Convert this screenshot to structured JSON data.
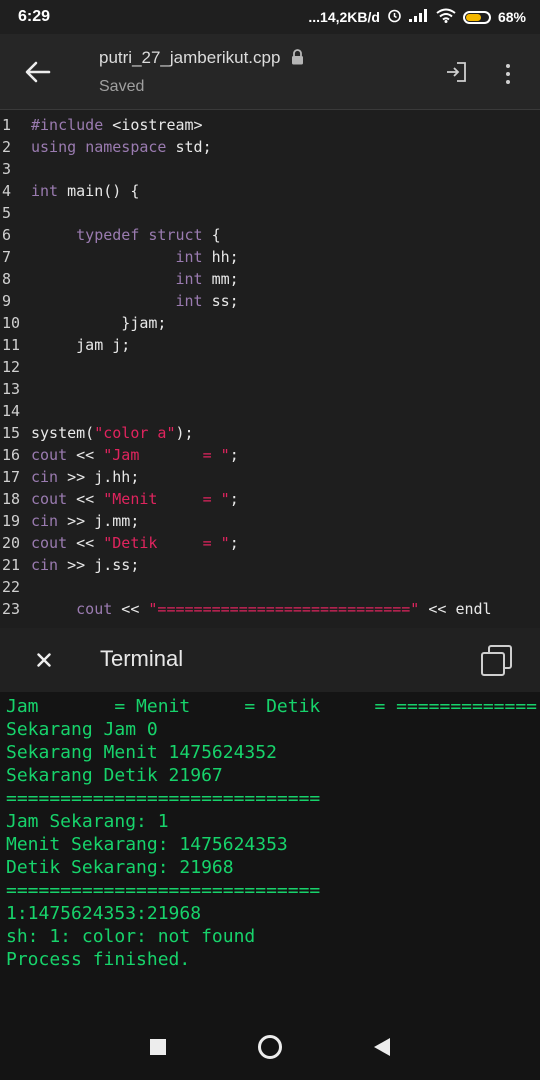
{
  "status_bar": {
    "time": "6:29",
    "network_speed": "...14,2KB/d",
    "battery_percent": "68%",
    "battery_level": 0.68,
    "icons": [
      "alarm-icon",
      "signal-icon",
      "wifi-icon",
      "battery-icon"
    ]
  },
  "app_bar": {
    "file_name": "putri_27_jamberikut.cpp",
    "status": "Saved",
    "icons": [
      "back-arrow-icon",
      "lock-icon",
      "enter-icon",
      "more-vert-icon"
    ]
  },
  "editor": {
    "lines": [
      {
        "n": "1",
        "segs": [
          {
            "t": "#include",
            "c": "kw"
          },
          {
            "t": " <iostream>",
            "c": ""
          }
        ]
      },
      {
        "n": "2",
        "segs": [
          {
            "t": "using",
            "c": "kw"
          },
          {
            "t": " ",
            "c": ""
          },
          {
            "t": "namespace",
            "c": "kw"
          },
          {
            "t": " std;",
            "c": ""
          }
        ]
      },
      {
        "n": "3",
        "segs": []
      },
      {
        "n": "4",
        "segs": [
          {
            "t": "int",
            "c": "kw"
          },
          {
            "t": " main() {",
            "c": ""
          }
        ]
      },
      {
        "n": "5",
        "segs": []
      },
      {
        "n": "6",
        "segs": [
          {
            "t": "     ",
            "c": ""
          },
          {
            "t": "typedef",
            "c": "kw"
          },
          {
            "t": " ",
            "c": ""
          },
          {
            "t": "struct",
            "c": "kw"
          },
          {
            "t": " {",
            "c": ""
          }
        ]
      },
      {
        "n": "7",
        "segs": [
          {
            "t": "                ",
            "c": ""
          },
          {
            "t": "int",
            "c": "kw"
          },
          {
            "t": " hh;",
            "c": ""
          }
        ]
      },
      {
        "n": "8",
        "segs": [
          {
            "t": "                ",
            "c": ""
          },
          {
            "t": "int",
            "c": "kw"
          },
          {
            "t": " mm;",
            "c": ""
          }
        ]
      },
      {
        "n": "9",
        "segs": [
          {
            "t": "                ",
            "c": ""
          },
          {
            "t": "int",
            "c": "kw"
          },
          {
            "t": " ss;",
            "c": ""
          }
        ]
      },
      {
        "n": "10",
        "segs": [
          {
            "t": "          }jam;",
            "c": ""
          }
        ]
      },
      {
        "n": "11",
        "segs": [
          {
            "t": "     jam j;",
            "c": ""
          }
        ]
      },
      {
        "n": "12",
        "segs": []
      },
      {
        "n": "13",
        "segs": []
      },
      {
        "n": "14",
        "segs": []
      },
      {
        "n": "15",
        "segs": [
          {
            "t": "system(",
            "c": ""
          },
          {
            "t": "\"color a\"",
            "c": "str"
          },
          {
            "t": ");",
            "c": ""
          }
        ]
      },
      {
        "n": "16",
        "segs": [
          {
            "t": "cout",
            "c": "kw"
          },
          {
            "t": " << ",
            "c": ""
          },
          {
            "t": "\"Jam       = \"",
            "c": "str"
          },
          {
            "t": ";",
            "c": ""
          }
        ]
      },
      {
        "n": "17",
        "segs": [
          {
            "t": "cin",
            "c": "kw"
          },
          {
            "t": " >> j.hh;",
            "c": ""
          }
        ]
      },
      {
        "n": "18",
        "segs": [
          {
            "t": "cout",
            "c": "kw"
          },
          {
            "t": " << ",
            "c": ""
          },
          {
            "t": "\"Menit     = \"",
            "c": "str"
          },
          {
            "t": ";",
            "c": ""
          }
        ]
      },
      {
        "n": "19",
        "segs": [
          {
            "t": "cin",
            "c": "kw"
          },
          {
            "t": " >> j.mm;",
            "c": ""
          }
        ]
      },
      {
        "n": "20",
        "segs": [
          {
            "t": "cout",
            "c": "kw"
          },
          {
            "t": " << ",
            "c": ""
          },
          {
            "t": "\"Detik     = \"",
            "c": "str"
          },
          {
            "t": ";",
            "c": ""
          }
        ]
      },
      {
        "n": "21",
        "segs": [
          {
            "t": "cin",
            "c": "kw"
          },
          {
            "t": " >> j.ss;",
            "c": ""
          }
        ]
      },
      {
        "n": "22",
        "segs": []
      },
      {
        "n": "23",
        "segs": [
          {
            "t": "     ",
            "c": ""
          },
          {
            "t": "cout",
            "c": "kw"
          },
          {
            "t": " << ",
            "c": ""
          },
          {
            "t": "\"============================\"",
            "c": "str"
          },
          {
            "t": " << endl",
            "c": ""
          }
        ]
      }
    ]
  },
  "terminal": {
    "title": "Terminal",
    "output": [
      "Jam       = Menit     = Detik     = =============",
      "Sekarang Jam 0",
      "Sekarang Menit 1475624352",
      "Sekarang Detik 21967",
      "=============================",
      "Jam Sekarang: 1",
      "Menit Sekarang: 1475624353",
      "Detik Sekarang: 21968",
      "=============================",
      "1:1475624353:21968",
      "sh: 1: color: not found",
      "Process finished."
    ]
  },
  "colors": {
    "keyword": "#9a7bb0",
    "string": "#e0245e",
    "terminal_text": "#17d36b"
  }
}
